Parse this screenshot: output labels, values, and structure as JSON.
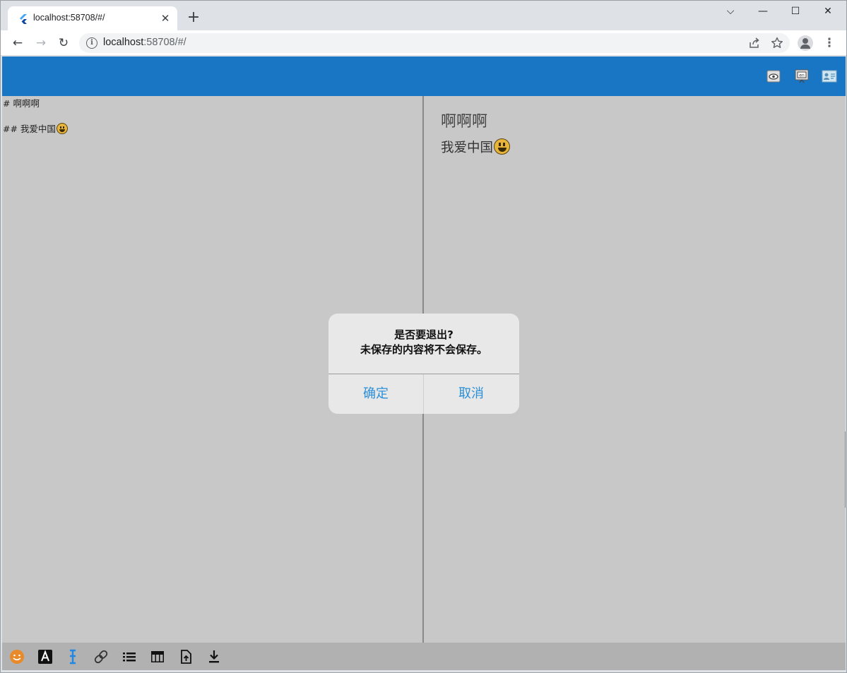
{
  "browser": {
    "tab_title": "localhost:58708/#/",
    "url_host": "localhost",
    "url_rest": ":58708/#/",
    "new_tab_glyph": "+",
    "close_glyph": "✕",
    "controls": {
      "dropdown": "⌵",
      "minimize": "—",
      "maximize": "☐",
      "close": "✕"
    },
    "nav": {
      "back": "←",
      "forward": "→",
      "reload": "↻"
    },
    "icons": [
      "info-icon",
      "share-icon",
      "star-icon",
      "profile-icon",
      "menu-icon"
    ]
  },
  "app": {
    "accent_color": "#1976c5",
    "appbar_icons": [
      "preview-icon",
      "presentation-icon",
      "contact-card-icon"
    ],
    "editor": {
      "line1": "# 啊啊啊",
      "line2": "## 我爱中国"
    },
    "preview": {
      "heading1": "啊啊啊",
      "heading2": "我爱中国"
    },
    "bottom_icons": [
      "emoji-icon",
      "font-icon",
      "cursor-text-icon",
      "link-icon",
      "list-icon",
      "table-icon",
      "file-upload-icon",
      "download-icon"
    ]
  },
  "dialog": {
    "title_line1": "是否要退出?",
    "title_line2": "未保存的内容将不会保存。",
    "confirm_label": "确定",
    "cancel_label": "取消"
  }
}
